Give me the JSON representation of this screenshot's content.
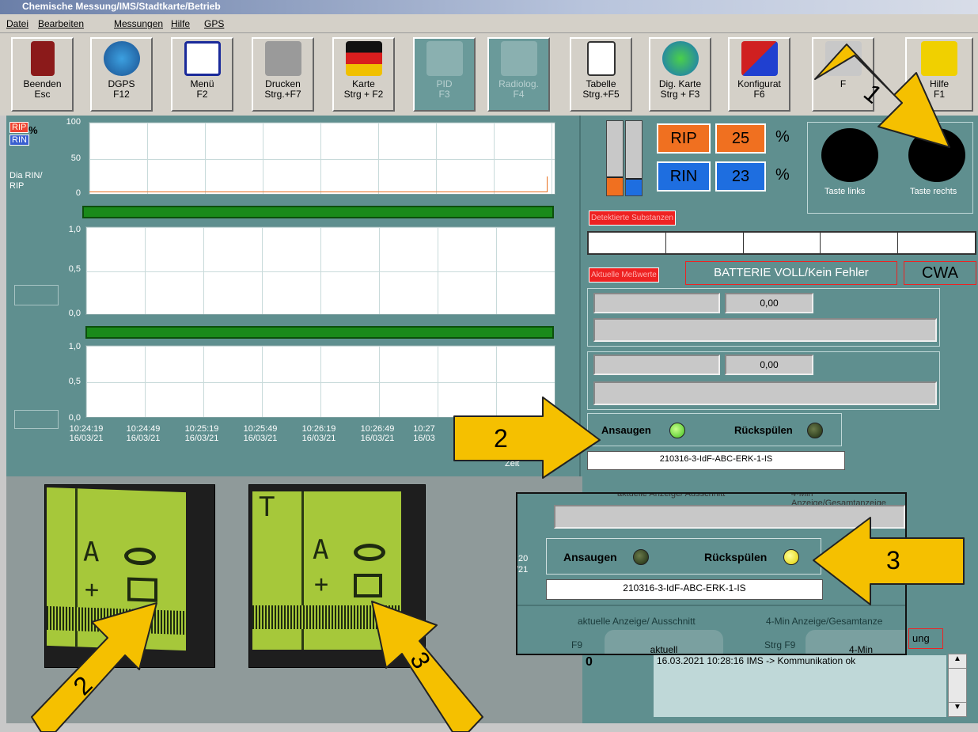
{
  "window": {
    "title": "Chemische Messung/IMS/Stadtkarte/Betrieb"
  },
  "menu": [
    "Datei",
    "Bearbeiten",
    "Messungen",
    "Hilfe",
    "GPS"
  ],
  "toolbar": [
    {
      "l1": "Beenden",
      "l2": "Esc",
      "icon": "door-exit-icon",
      "disabled": false
    },
    {
      "l1": "DGPS",
      "l2": "F12",
      "icon": "globe-satellite-icon",
      "disabled": false
    },
    {
      "l1": "Menü",
      "l2": "F2",
      "icon": "menu-list-icon",
      "disabled": false
    },
    {
      "l1": "Drucken",
      "l2": "Strg.+F7",
      "icon": "printer-icon",
      "disabled": false
    },
    {
      "l1": "Karte",
      "l2": "Strg + F2",
      "icon": "germany-map-icon",
      "disabled": false
    },
    {
      "l1": "PID",
      "l2": "F3",
      "icon": "bar-chart-icon",
      "disabled": true
    },
    {
      "l1": "Radiolog.",
      "l2": "F4",
      "icon": "line-chart-icon",
      "disabled": true
    },
    {
      "l1": "Tabelle",
      "l2": "Strg.+F5",
      "icon": "table-icon",
      "disabled": false
    },
    {
      "l1": "Dig. Karte",
      "l2": "Strg + F3",
      "icon": "earth-icon",
      "disabled": false
    },
    {
      "l1": "Konfigurat",
      "l2": "F6",
      "icon": "config-arrows-icon",
      "disabled": false
    },
    {
      "l1": "",
      "l2": "F",
      "icon": "pencil-icon",
      "disabled": false
    },
    {
      "l1": "Hilfe",
      "l2": "F1",
      "icon": "help-icon",
      "disabled": false
    }
  ],
  "chart1": {
    "rip_tag": "RIP",
    "rin_tag": "RIN",
    "unit": "%",
    "side_label_1": "Dia RIN/",
    "side_label_2": "RIP",
    "y100": "100",
    "y50": "50",
    "y0": "0"
  },
  "chart2": {
    "y1": "1,0",
    "y05": "0,5",
    "y0": "0,0"
  },
  "chart3": {
    "y1": "1,0",
    "y05": "0,5",
    "y0": "0,0"
  },
  "x_axis": [
    {
      "t": "10:24:19",
      "d": "16/03/21"
    },
    {
      "t": "10:24:49",
      "d": "16/03/21"
    },
    {
      "t": "10:25:19",
      "d": "16/03/21"
    },
    {
      "t": "10:25:49",
      "d": "16/03/21"
    },
    {
      "t": "10:26:19",
      "d": "16/03/21"
    },
    {
      "t": "10:26:49",
      "d": "16/03/21"
    },
    {
      "t": "10:27",
      "d": "16/03"
    }
  ],
  "x_axis_title": "Zeit",
  "gauges": {
    "rip_label": "RIP",
    "rip_value": "25",
    "rin_label": "RIN",
    "rin_value": "23",
    "unit": "%",
    "rip_color": "#f07020",
    "rin_color": "#1e6ee0"
  },
  "taste": {
    "left": "Taste links",
    "right": "Taste rechts"
  },
  "substanzen_label": "Detektierte Substanzen",
  "messwerte_label": "Aktuelle Meßwerte",
  "battery_status": "BATTERIE VOLL/Kein Fehler",
  "mode": "CWA",
  "value1": "0,00",
  "value2": "0,00",
  "ansaugen": "Ansaugen",
  "rueckspuelen": "Rückspülen",
  "sample_id": "210316-3-IdF-ABC-ERK-1-IS",
  "zoom": {
    "tab_left_top": "aktuelle Anzeige/ Ausschnitt",
    "tab_right_top": "4-Min Anzeige/Gesamtanzeige",
    "ansaugen": "Ansaugen",
    "rueckspuelen": "Rückspülen",
    "sample_id": "210316-3-IdF-ABC-ERK-1-IS",
    "tab_left": "aktuelle Anzeige/ Ausschnitt",
    "tab_right": "4-Min Anzeige/Gesamtanze",
    "key_left": "F9",
    "key_right": "Strg F9",
    "btn_left": "aktuell",
    "btn_right": "4-Min",
    "partial_right": "ung",
    "time_partial_1": ":20",
    "time_partial_2": "/21"
  },
  "log": {
    "count": "0",
    "entry": "16.03.2021 10:28:16 IMS -> Kommunikation ok"
  },
  "lcd1": {
    "t1": "A",
    "t2": "+"
  },
  "lcd2": {
    "t0": "T",
    "t1": "A",
    "t2": "+"
  },
  "callouts": {
    "a1": "1",
    "a2": "2",
    "a2b": "2",
    "a3": "3",
    "a3b": "3"
  }
}
